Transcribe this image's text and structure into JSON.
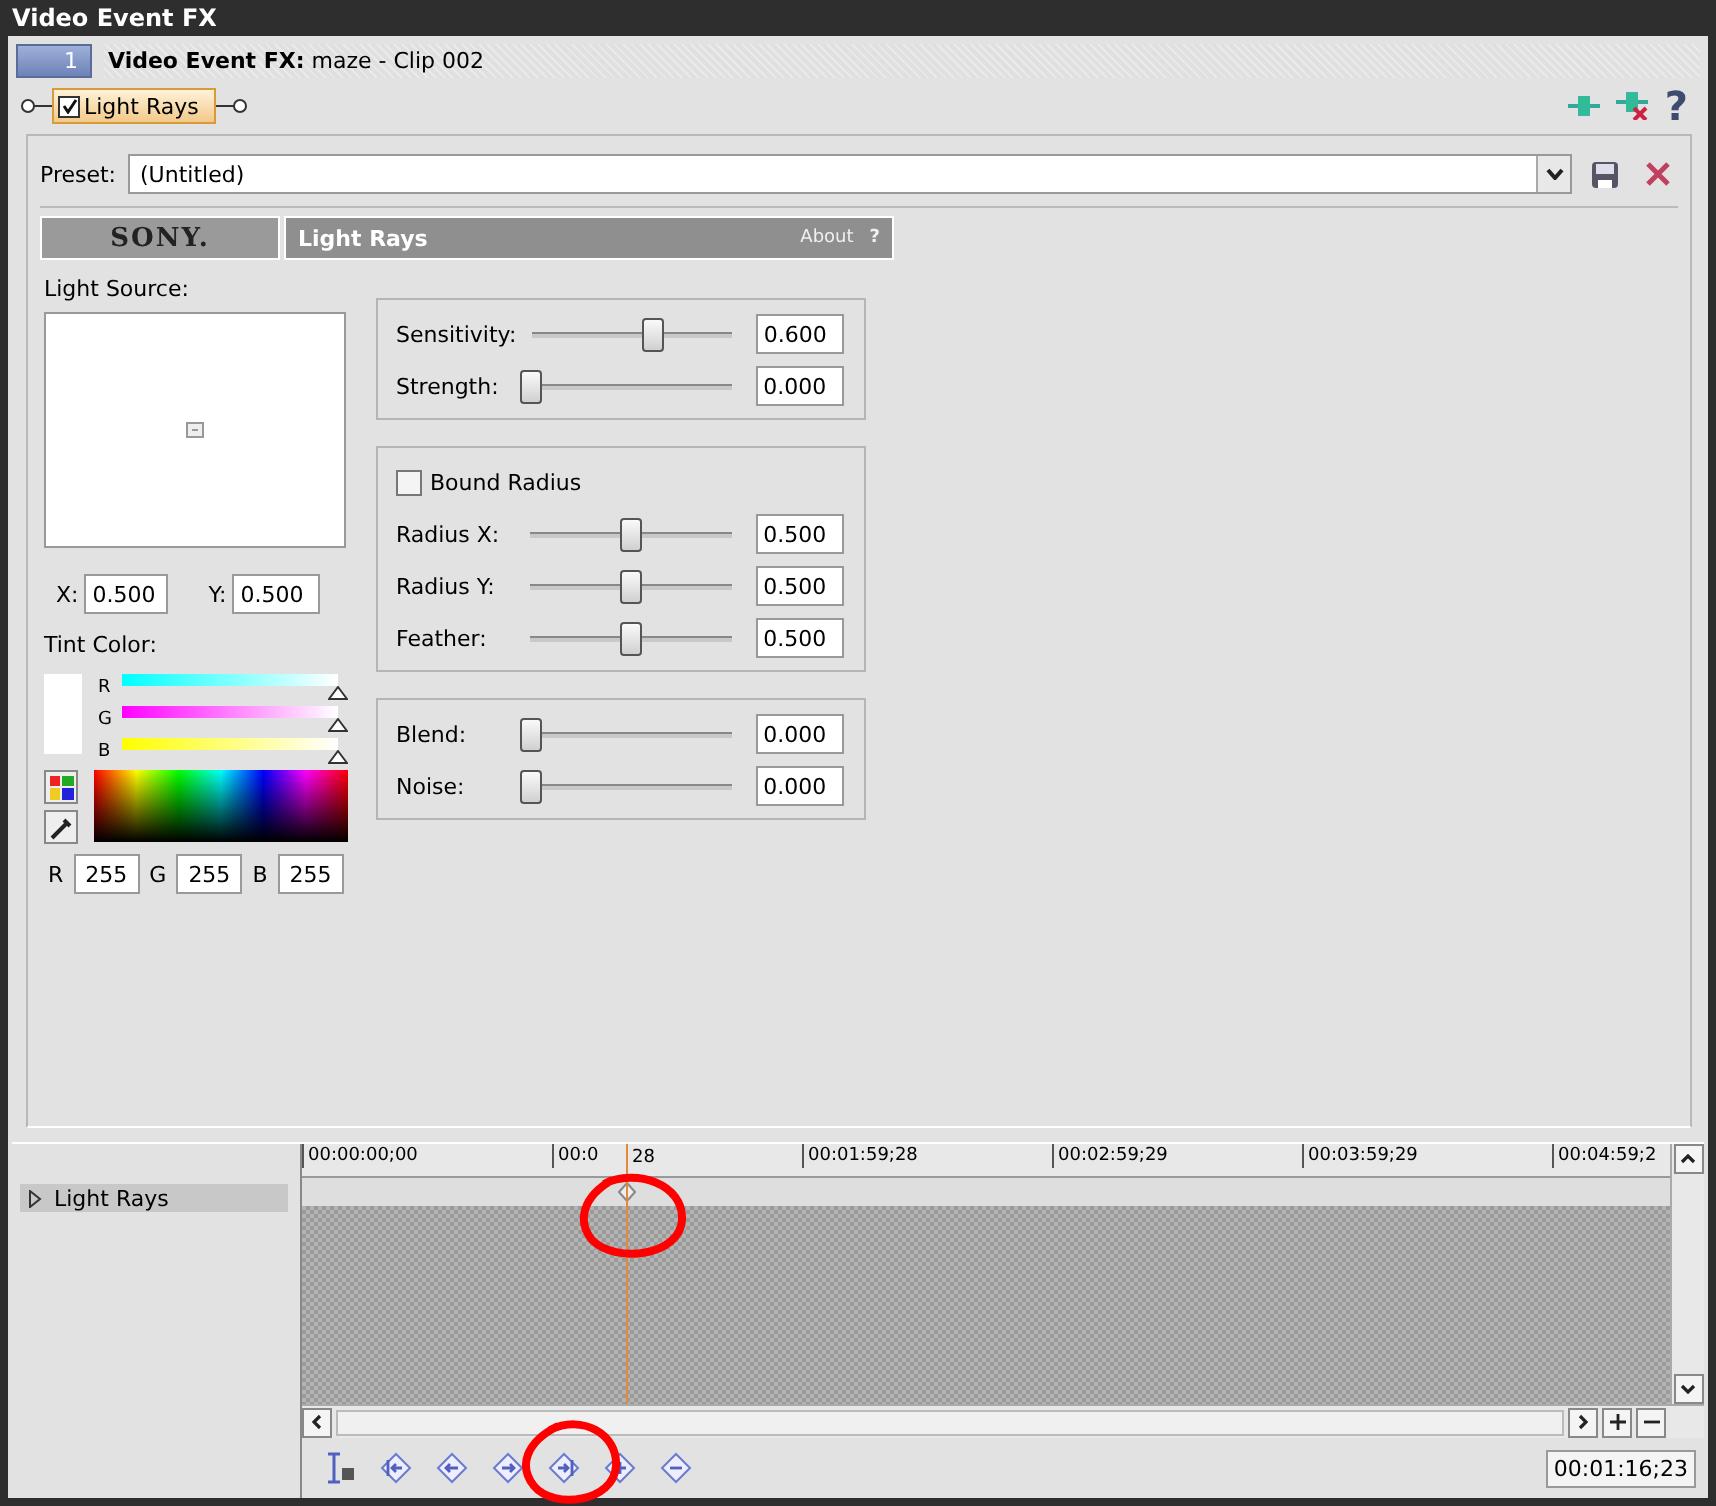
{
  "window": {
    "title": "Video Event FX"
  },
  "header": {
    "tab_number": "1",
    "label": "Video Event FX:",
    "clip": "maze - Clip 002"
  },
  "chain": {
    "plugin": {
      "label": "Light Rays",
      "checked": true
    },
    "help": "?"
  },
  "preset": {
    "label": "Preset:",
    "value": "(Untitled)"
  },
  "plugin_header": {
    "brand": "SONY.",
    "title": "Light Rays",
    "about": "About",
    "help": "?"
  },
  "light_source": {
    "label": "Light Source:",
    "x_label": "X:",
    "x_value": "0.500",
    "y_label": "Y:",
    "y_value": "0.500"
  },
  "tint_color": {
    "label": "Tint Color:",
    "channels": [
      {
        "label": "R",
        "level": 1
      },
      {
        "label": "G",
        "level": 1
      },
      {
        "label": "B",
        "level": 1
      }
    ],
    "fields": [
      {
        "label": "R",
        "value": "255"
      },
      {
        "label": "G",
        "value": "255"
      },
      {
        "label": "B",
        "value": "255"
      }
    ]
  },
  "groups": [
    {
      "rows": [
        {
          "kind": "slider",
          "label": "Sensitivity:",
          "level": 0.6,
          "value": "0.600"
        },
        {
          "kind": "slider",
          "label": "Strength:",
          "level": 0,
          "value": "0.000"
        }
      ]
    },
    {
      "rows": [
        {
          "kind": "checkbox",
          "label": "Bound Radius",
          "checked": false
        },
        {
          "kind": "slider",
          "label": "Radius X:",
          "level": 0.5,
          "value": "0.500"
        },
        {
          "kind": "slider",
          "label": "Radius Y:",
          "level": 0.5,
          "value": "0.500"
        },
        {
          "kind": "slider",
          "label": "Feather:",
          "level": 0.5,
          "value": "0.500"
        }
      ]
    },
    {
      "rows": [
        {
          "kind": "slider",
          "label": "Blend:",
          "level": 0,
          "value": "0.000"
        },
        {
          "kind": "slider",
          "label": "Noise:",
          "level": 0,
          "value": "0.000"
        }
      ]
    }
  ],
  "timeline": {
    "track": {
      "label": "Light Rays",
      "expanded": false
    },
    "ruler": [
      "00:00:00;00",
      "00:0",
      "00:01:59;28",
      "00:02:59;29",
      "00:03:59;29",
      "00:04:59;2"
    ],
    "ruler_tail": "28",
    "time": "00:01:16;23"
  }
}
